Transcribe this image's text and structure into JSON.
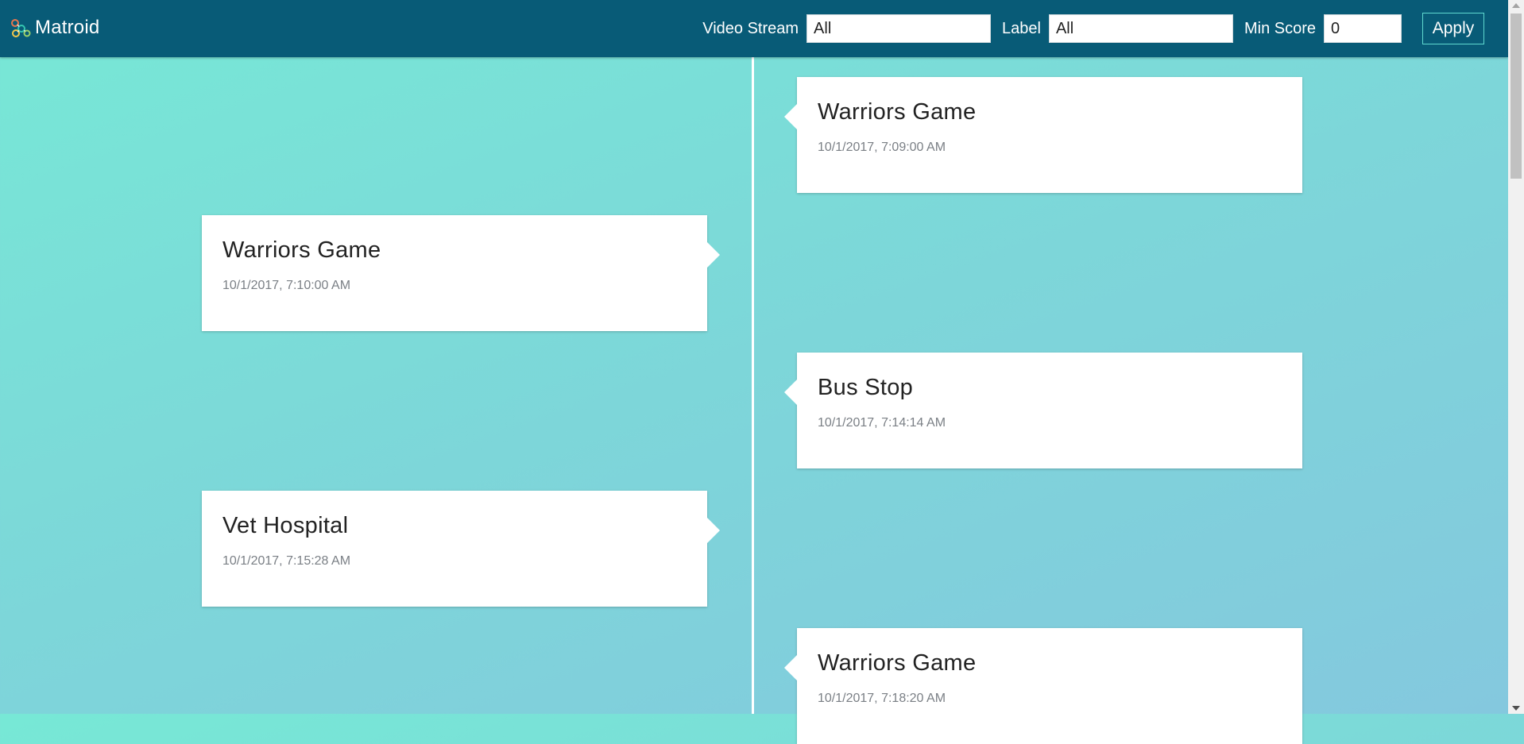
{
  "brand": {
    "name": "Matroid",
    "logo_icon": "matroid-logo-icon",
    "colors": {
      "header_bg": "#085b77",
      "accent": "#5fd8cf"
    }
  },
  "filters": {
    "video_stream_label": "Video Stream",
    "video_stream_value": "All",
    "label_label": "Label",
    "label_value": "All",
    "min_score_label": "Min Score",
    "min_score_value": "0",
    "apply_label": "Apply"
  },
  "timeline": {
    "events": [
      {
        "title": "Warriors Game",
        "time": "10/1/2017, 7:09:00 AM",
        "side": "right"
      },
      {
        "title": "Warriors Game",
        "time": "10/1/2017, 7:10:00 AM",
        "side": "left"
      },
      {
        "title": "Bus Stop",
        "time": "10/1/2017, 7:14:14 AM",
        "side": "right"
      },
      {
        "title": "Vet Hospital",
        "time": "10/1/2017, 7:15:28 AM",
        "side": "left"
      },
      {
        "title": "Warriors Game",
        "time": "10/1/2017, 7:18:20 AM",
        "side": "right"
      }
    ]
  }
}
